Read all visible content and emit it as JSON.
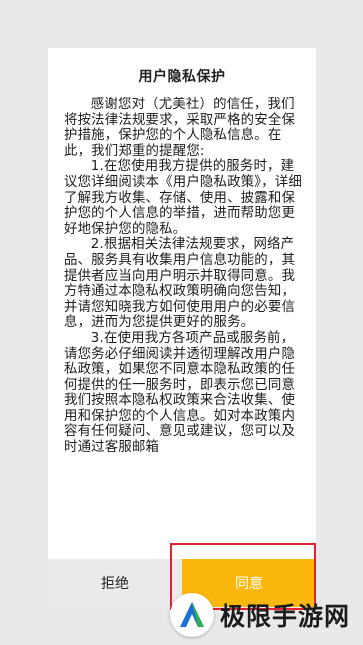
{
  "dialog": {
    "title": "用户隐私保护",
    "paragraphs": [
      "感谢您对（尤美社）的信任，我们将按法律法规要求，采取严格的安全保护措施，保护您的个人隐私信息。在此，我们郑重的提醒您:",
      "1.在您使用我方提供的服务时，建议您详细阅读本《用户隐私政策》，详细了解我方收集、存储、使用、披露和保护您的个人信息的举措，进而帮助您更好地保护您的隐私。",
      "2.根据相关法律法规要求，网络产品、服务具有收集用户信息功能的，其提供者应当向用户明示并取得同意。我方特通过本隐私权政策明确向您告知，并请您知晓我方如何使用用户的必要信息，进而为您提供更好的服务。",
      "3.在使用我方各项产品或服务前，请您务必仔细阅读并透彻理解改用户隐私政策，如果您不同意本隐私政策的任何提供的任一服务时，即表示您已同意我们按照本隐私权政策来合法收集、使用和保护您的个人信息。如对本政策内容有任何疑问、意见或建议，您可以及时通过客服邮箱"
    ],
    "reject_label": "拒绝",
    "agree_label": "同意"
  },
  "watermark": {
    "text": "极限手游网"
  },
  "colors": {
    "agree_button": "#fbb70c",
    "reject_button": "#ebebeb",
    "highlight_border": "#e2222e",
    "background": "#e9e9e9"
  }
}
